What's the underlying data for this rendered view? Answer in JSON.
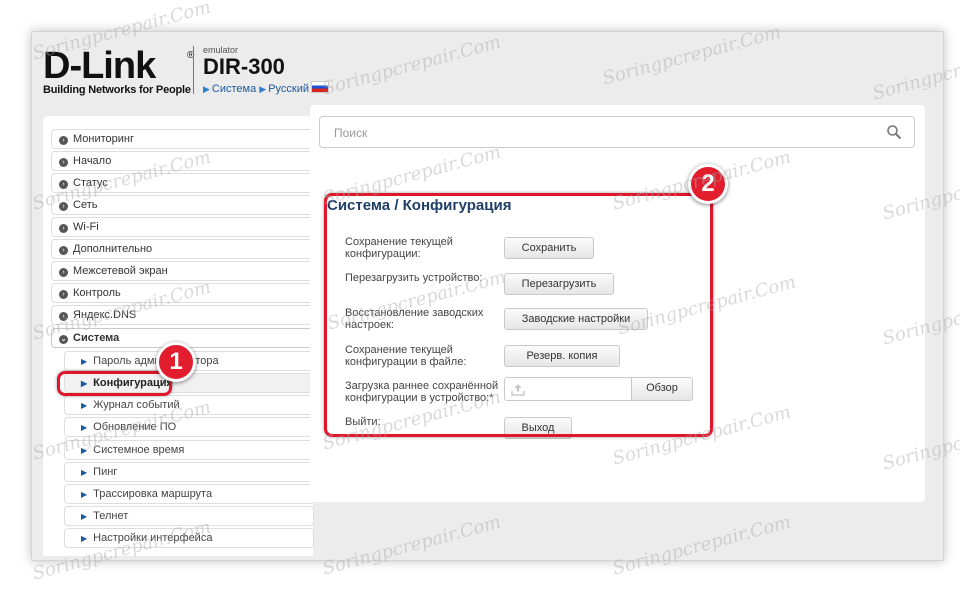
{
  "brand": {
    "logo": "D-Link",
    "registered": "®",
    "tagline": "Building Networks for People",
    "emulator": "emulator",
    "model": "DIR-300",
    "crumbs": [
      "Система",
      "Русский"
    ]
  },
  "search": {
    "placeholder": "Поиск"
  },
  "sidebar": {
    "items": [
      {
        "label": "Мониторинг"
      },
      {
        "label": "Начало"
      },
      {
        "label": "Статус"
      },
      {
        "label": "Сеть"
      },
      {
        "label": "Wi-Fi"
      },
      {
        "label": "Дополнительно"
      },
      {
        "label": "Межсетевой экран"
      },
      {
        "label": "Контроль"
      },
      {
        "label": "Яндекс.DNS"
      },
      {
        "label": "Система"
      }
    ],
    "sub_items": [
      {
        "label": "Пароль администратора"
      },
      {
        "label": "Конфигурация"
      },
      {
        "label": "Журнал событий"
      },
      {
        "label": "Обновление ПО"
      },
      {
        "label": "Системное время"
      },
      {
        "label": "Пинг"
      },
      {
        "label": "Трассировка маршрута"
      },
      {
        "label": "Телнет"
      },
      {
        "label": "Настройки интерфейса"
      }
    ]
  },
  "page": {
    "title_section": "Система",
    "title_separator": "/",
    "title_page": "Конфигурация"
  },
  "config": {
    "save_label": "Сохранение текущей\nконфигурации:",
    "save_button": "Сохранить",
    "reboot_label": "Перезагрузить устройство:",
    "reboot_button": "Перезагрузить",
    "factory_label": "Восстановление заводских\nнастроек:",
    "factory_button": "Заводские настройки",
    "backup_label": "Сохранение текущей\nконфигурации в файле:",
    "backup_button": "Резерв. копия",
    "upload_label": "Загрузка раннее сохранённой\nконфигурации в устройство:*",
    "browse_button": "Обзор",
    "logout_label": "Выйти:",
    "logout_button": "Выход"
  },
  "annotations": {
    "badge1": "1",
    "badge2": "2",
    "highlight_color": "#e0162b"
  },
  "watermark": "Soringpcrepair.Com"
}
